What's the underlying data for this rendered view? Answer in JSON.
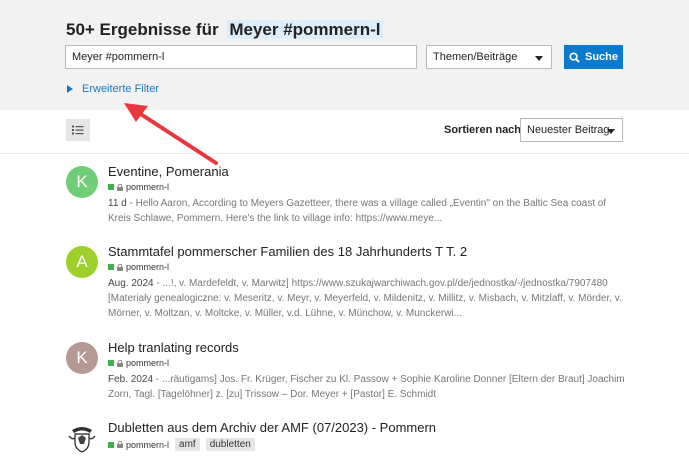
{
  "header": {
    "title_prefix": "50+ Ergebnisse für",
    "title_query": "Meyer #pommern-l"
  },
  "search": {
    "value": "Meyer #pommern-l",
    "type_value": "Themen/Beiträge",
    "button_label": "Suche"
  },
  "filters": {
    "label": "Erweiterte Filter"
  },
  "sort": {
    "label": "Sortieren nach",
    "value": "Neuester Beitrag"
  },
  "results": [
    {
      "avatar_letter": "K",
      "avatar_color": "#6fce76",
      "title": "Eventine, Pomerania",
      "category": "pommern-l",
      "date": "11 d",
      "excerpt": " - Hello Aaron, According to Meyers Gazetteer, there was a village called „Eventin\" on the Baltic Sea coast of Kreis Schlawe, Pommern. Here's the link to village info: https://www.meye..."
    },
    {
      "avatar_letter": "A",
      "avatar_color": "#9ed02c",
      "title": "Stammtafel pommerscher Familien des 18 Jahrhunderts T T. 2",
      "category": "pommern-l",
      "date": "Aug. 2024",
      "excerpt": " - ...!, v. Mardefeldt, v. Marwitz] https://www.szukajwarchiwach.gov.pl/de/jednostka/-/jednostka/7907480 [Materiały genealogiczne: v. Meseritz, v. Meyr, v. Meyerfeld, v. Mildenitz, v. Millitz, v. Misbach, v. Mitzlaff, v. Mörder, v. Mörner, v. Moltzan, v. Moltcke, v. Müller, v.d. Lühne, v. Münchow, v. Munckerwi..."
    },
    {
      "avatar_letter": "K",
      "avatar_color": "#b59a94",
      "title": "Help tranlating records",
      "category": "pommern-l",
      "date": "Feb. 2024",
      "excerpt": " - ...räutigams] Jos. Fr. Krüger, Fischer zu Kl. Passow + Sophie Karoline Donner [Eltern der Braut] Joachim Zorn, Tagl. [Tagelöhner] z. [zu] Trissow – Dor. Meyer + [Pastor] E. Schmidt"
    },
    {
      "title": "Dubletten aus dem Archiv der AMF (07/2023) - Pommern",
      "category": "pommern-l",
      "tags": [
        "amf",
        "dubletten"
      ]
    }
  ],
  "colors": {
    "accent": "#0a7aca",
    "link": "#1a78b8",
    "category": "#3ab54a",
    "annotation_arrow": "#e8383d"
  }
}
